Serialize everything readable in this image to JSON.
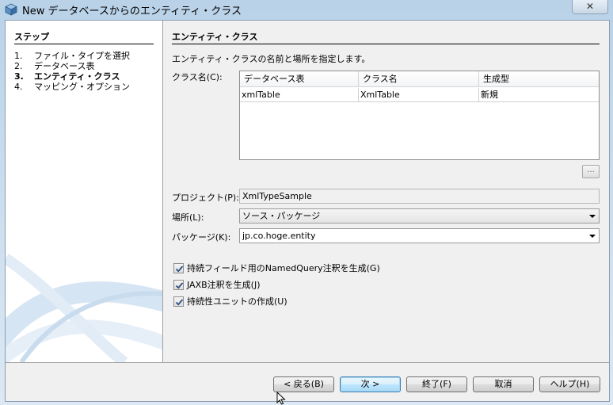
{
  "window": {
    "title": "New データベースからのエンティティ・クラス",
    "close_glyph": "✕"
  },
  "steps": {
    "title": "ステップ",
    "items": [
      {
        "num": "1.",
        "label": "ファイル・タイプを選択"
      },
      {
        "num": "2.",
        "label": "データベース表"
      },
      {
        "num": "3.",
        "label": "エンティティ・クラス"
      },
      {
        "num": "4.",
        "label": "マッピング・オプション"
      }
    ]
  },
  "content": {
    "title": "エンティティ・クラス",
    "description": "エンティティ・クラスの名前と場所を指定します。",
    "class_names_label": "クラス名(C):",
    "table": {
      "headers": [
        "データベース表",
        "クラス名",
        "生成型"
      ],
      "rows": [
        [
          "xmlTable",
          "XmlTable",
          "新規"
        ]
      ]
    },
    "ellipsis_button": "...",
    "project_label": "プロジェクト(P):",
    "project_value": "XmlTypeSample",
    "location_label": "場所(L):",
    "location_value": "ソース・パッケージ",
    "package_label": "パッケージ(K):",
    "package_value": "jp.co.hoge.entity",
    "checkboxes": [
      {
        "label": "持続フィールド用のNamedQuery注釈を生成(G)",
        "checked": true
      },
      {
        "label": "JAXB注釈を生成(J)",
        "checked": true
      },
      {
        "label": "持続性ユニットの作成(U)",
        "checked": true
      }
    ]
  },
  "buttons": {
    "back": "< 戻る(B)",
    "next": "次 >",
    "finish": "終了(F)",
    "cancel": "取消",
    "help": "ヘルプ(H)"
  },
  "colors": {
    "accent": "#3c7fb1",
    "panel": "#f0f0f0"
  }
}
